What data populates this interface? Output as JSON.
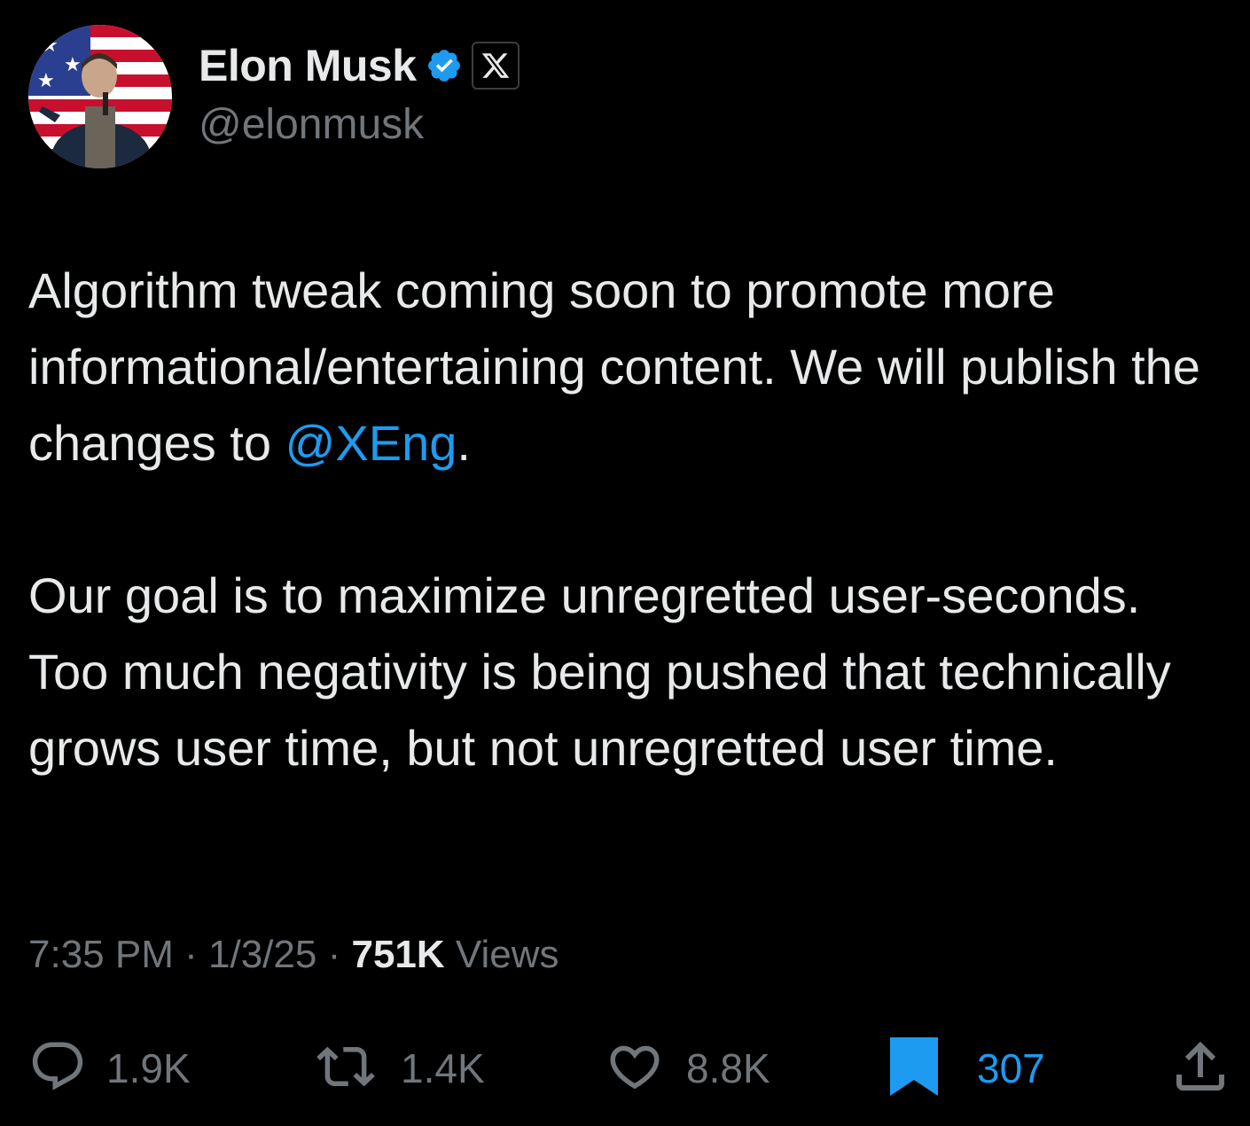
{
  "author": {
    "display_name": "Elon Musk",
    "handle": "@elonmusk",
    "verified": true,
    "affiliation_badge": "x-logo-icon"
  },
  "tweet": {
    "paragraph1_text": "Algorithm tweak coming soon to promote more informational/entertaining content. We will publish the changes to ",
    "paragraph1_mention": "@XEng",
    "paragraph1_end": ".",
    "paragraph2": "Our goal is to maximize unregretted user-seconds. Too much negativity is being pushed that technically grows user time, but not unregretted user time."
  },
  "meta": {
    "time": "7:35 PM",
    "separator": "·",
    "date": "1/3/25",
    "views_count": "751K",
    "views_label": "Views"
  },
  "actions": {
    "replies": "1.9K",
    "reposts": "1.4K",
    "likes": "8.8K",
    "bookmarks": "307"
  },
  "colors": {
    "background": "#000000",
    "text_primary": "#e7e9ea",
    "text_secondary": "#71767b",
    "accent": "#1d9bf0"
  },
  "icons": {
    "reply": "reply-icon",
    "repost": "repost-icon",
    "like": "heart-icon",
    "bookmark": "bookmark-icon",
    "share": "share-icon",
    "verified": "verified-icon"
  }
}
